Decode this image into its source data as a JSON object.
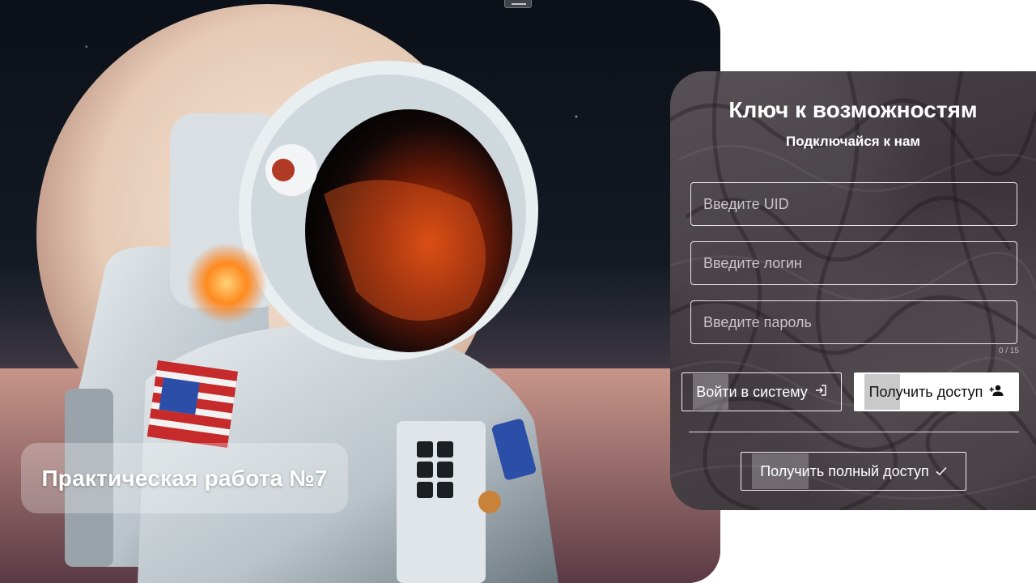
{
  "hero": {
    "caption": "Практическая работа №7"
  },
  "auth": {
    "title": "Ключ к возможностям",
    "subtitle": "Подключайся к нам",
    "uid_placeholder": "Введите UID",
    "login_placeholder": "Введите логин",
    "password_placeholder": "Введите пароль",
    "password_counter": "0 / 15",
    "login_button": "Войти в систему",
    "register_button": "Получить доступ",
    "full_access_button": "Получить полный доступ",
    "icons": {
      "login": "login-arrow-icon",
      "register": "person-add-icon",
      "full_access": "checkmark-icon"
    }
  }
}
